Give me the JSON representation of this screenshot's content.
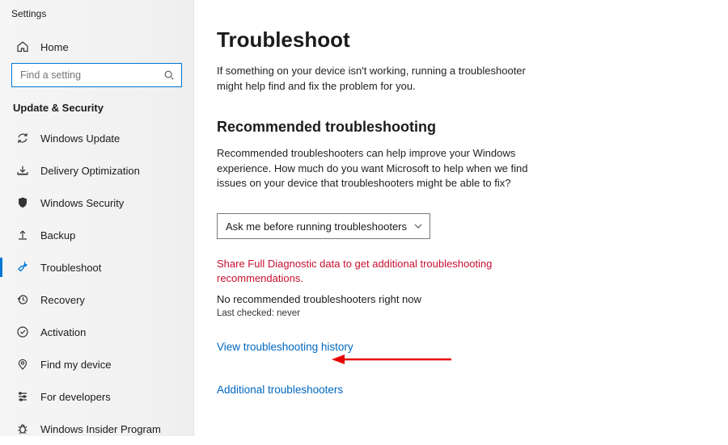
{
  "window": {
    "title": "Settings"
  },
  "search": {
    "placeholder": "Find a setting"
  },
  "category": {
    "label": "Update & Security"
  },
  "nav": {
    "home": "Home",
    "items": [
      {
        "id": "windows-update",
        "label": "Windows Update"
      },
      {
        "id": "delivery-optimization",
        "label": "Delivery Optimization"
      },
      {
        "id": "windows-security",
        "label": "Windows Security"
      },
      {
        "id": "backup",
        "label": "Backup"
      },
      {
        "id": "troubleshoot",
        "label": "Troubleshoot"
      },
      {
        "id": "recovery",
        "label": "Recovery"
      },
      {
        "id": "activation",
        "label": "Activation"
      },
      {
        "id": "find-my-device",
        "label": "Find my device"
      },
      {
        "id": "for-developers",
        "label": "For developers"
      },
      {
        "id": "windows-insider",
        "label": "Windows Insider Program"
      }
    ]
  },
  "main": {
    "title": "Troubleshoot",
    "intro": "If something on your device isn't working, running a troubleshooter might help find and fix the problem for you.",
    "rec_heading": "Recommended troubleshooting",
    "rec_desc": "Recommended troubleshooters can help improve your Windows experience. How much do you want Microsoft to help when we find issues on your device that troubleshooters might be able to fix?",
    "dropdown_value": "Ask me before running troubleshooters",
    "warning": "Share Full Diagnostic data to get additional troubleshooting recommendations.",
    "no_rec": "No recommended troubleshooters right now",
    "last_checked": "Last checked: never",
    "link_history": "View troubleshooting history",
    "link_additional": "Additional troubleshooters"
  },
  "colors": {
    "accent": "#0078d4",
    "link": "#0067c0",
    "danger": "#c8102e"
  }
}
